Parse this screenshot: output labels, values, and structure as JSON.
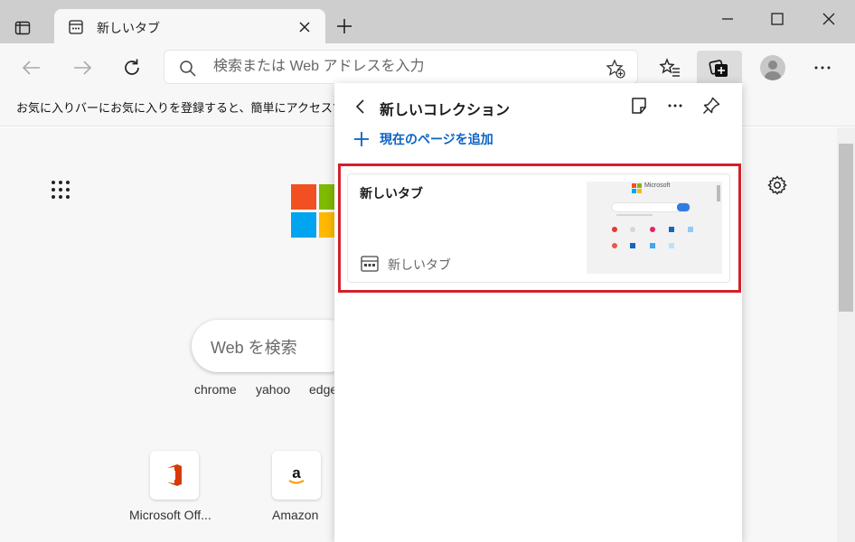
{
  "tab": {
    "title": "新しいタブ"
  },
  "address_bar": {
    "placeholder": "検索または Web アドレスを入力"
  },
  "favorites_bar": {
    "message": "お気に入りバーにお気に入りを登録すると、簡単にアクセスで"
  },
  "new_tab_page": {
    "search_placeholder": "Web を検索",
    "suggestions": [
      "chrome",
      "yahoo",
      "edge"
    ],
    "quick_links": [
      {
        "label": "Microsoft Off..."
      },
      {
        "label": "Amazon"
      }
    ]
  },
  "collections_panel": {
    "title": "新しいコレクション",
    "add_current_page_label": "現在のページを追加",
    "items": [
      {
        "title": "新しいタブ",
        "source": "新しいタブ",
        "thumbnail_brand": "Microsoft"
      }
    ]
  },
  "colors": {
    "accent": "#0b62c4",
    "highlight": "#d4202b"
  }
}
